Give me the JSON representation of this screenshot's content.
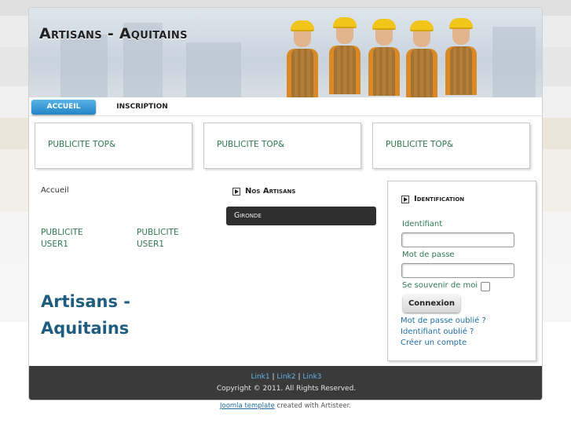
{
  "header": {
    "site_title": "Artisans - Aquitains"
  },
  "nav": {
    "tabs": [
      {
        "label": "ACCUEIL",
        "active": true
      },
      {
        "label": "INSCRIPTION",
        "active": false
      }
    ]
  },
  "top_ads": [
    "PUBLICITE TOP&",
    "PUBLICITE TOP&",
    "PUBLICITE TOP&"
  ],
  "breadcrumb": "Accueil",
  "user_ads": [
    {
      "line1": "PUBLICITE",
      "line2": "USER1"
    },
    {
      "line1": "PUBLICITE",
      "line2": "USER1"
    }
  ],
  "main_title": {
    "line1": "Artisans -",
    "line2": "Aquitains"
  },
  "artisans_block": {
    "heading": "Nos Artisans",
    "items": [
      "Gironde"
    ]
  },
  "login": {
    "heading": "Identification",
    "username_label": "Identifiant",
    "username_value": "",
    "password_label": "Mot de passe",
    "password_value": "",
    "remember_label": "Se souvenir de moi",
    "remember_checked": false,
    "submit_label": "Connexion",
    "forgot_password": "Mot de passe oublié ?",
    "forgot_username": "Identifiant oublié ?",
    "create_account": "Créer un compte"
  },
  "footer": {
    "links": [
      "Link1",
      "Link2",
      "Link3"
    ],
    "separator": "|",
    "copyright": "Copyright © 2011. All Rights Reserved."
  },
  "credit": {
    "link_text": "Joomla template",
    "text": " created with Artisteer."
  },
  "colors": {
    "accent_blue": "#2385c6",
    "link_green": "#2f7a52",
    "title_blue": "#1f5d7f",
    "footer_bg": "#3a3a3a"
  },
  "icons": [
    "arrow-right-icon"
  ]
}
